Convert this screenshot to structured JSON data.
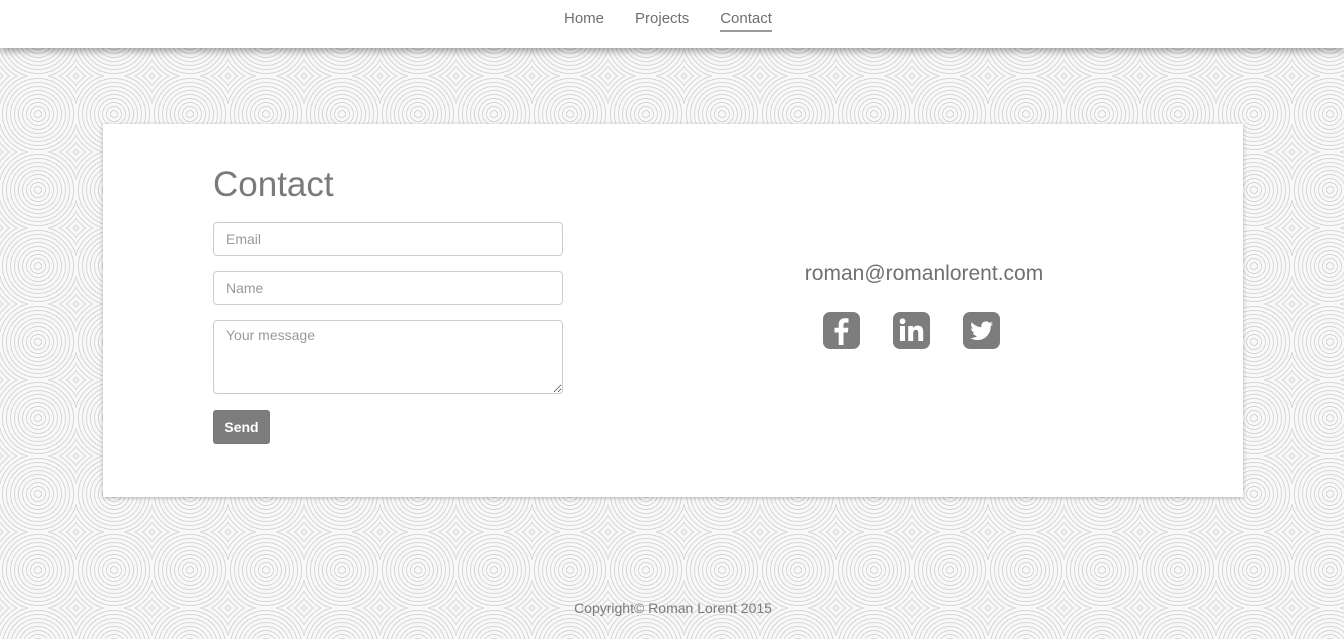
{
  "nav": {
    "items": [
      {
        "label": "Home"
      },
      {
        "label": "Projects"
      },
      {
        "label": "Contact"
      }
    ]
  },
  "contact_form": {
    "title": "Contact",
    "email_placeholder": "Email",
    "name_placeholder": "Name",
    "message_placeholder": "Your message",
    "send_label": "Send"
  },
  "contact_info": {
    "email": "roman@romanlorent.com",
    "social": [
      {
        "icon": "facebook-icon"
      },
      {
        "icon": "linkedin-icon"
      },
      {
        "icon": "twitter-icon"
      }
    ]
  },
  "footer": {
    "copyright": "Copyright© Roman Lorent 2015"
  },
  "colors": {
    "accent_gray": "#7d7d7d",
    "text_gray": "#7a7a7a",
    "card_bg": "#ffffff"
  }
}
